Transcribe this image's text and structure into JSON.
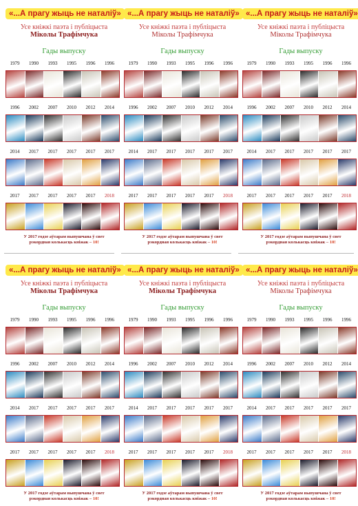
{
  "panel": {
    "title": "«...А прагу жыць не наталіў»",
    "subtitle_line1": "Усе кніжкі паэта і публіцыста",
    "subtitle_line2": "Міколы Трафімчука",
    "years_heading": "Гады выпуску",
    "rows": [
      {
        "years": [
          "1979",
          "1990",
          "1993",
          "1995",
          "1996",
          "1996"
        ],
        "covers": [
          "#b4443f",
          "#7a2a2a",
          "#e8e4d8",
          "#2a2a2a",
          "#c7c3b5",
          "#8a3a2a"
        ]
      },
      {
        "years": [
          "1996",
          "2002",
          "2007",
          "2010",
          "2012",
          "2014"
        ],
        "covers": [
          "#2a8ac0",
          "#1a3a5a",
          "#303030",
          "#c8c8c8",
          "#7a3a2a",
          "#2a4a6a"
        ]
      },
      {
        "years": [
          "2014",
          "2017",
          "2017",
          "2017",
          "2017",
          "2017"
        ],
        "covers": [
          "#3a7ac8",
          "#5a6a8a",
          "#c83a2a",
          "#d8c8a8",
          "#e0a040",
          "#2a3a6a"
        ]
      },
      {
        "years": [
          "2017",
          "2017",
          "2017",
          "2017",
          "2017",
          "2018"
        ],
        "covers": [
          "#c8a020",
          "#3a8ad8",
          "#e8d050",
          "#1a1a2a",
          "#2a0a0a",
          "#b02828"
        ]
      }
    ],
    "footer_line1": "У 2017 годзе аўтарам выпушчана ў свет",
    "footer_line2": "рэкордная колькасць кніжак –",
    "footer_count": "10!"
  },
  "colors": {
    "title_bg": "#ffe94a",
    "title_fg": "#c61a1a",
    "frame": "#b3262c",
    "heading": "#2f9a2f"
  }
}
